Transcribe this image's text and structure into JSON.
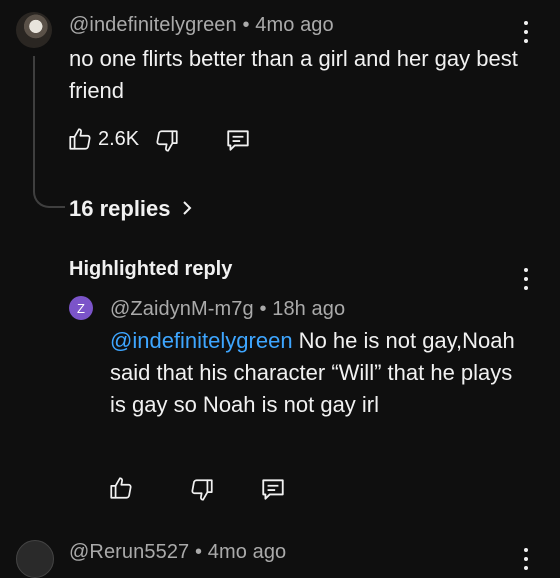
{
  "comment": {
    "author": "@indefinitelygreen",
    "separator": "•",
    "time": "4mo ago",
    "text": "no one flirts better than a girl and her gay best friend",
    "likes": "2.6K",
    "replies_label": "16 replies"
  },
  "highlighted": {
    "heading": "Highlighted reply",
    "avatar_letter": "Z",
    "author": "@ZaidynM-m7g",
    "separator": "•",
    "time": "18h ago",
    "mention": "@indefinitelygreen",
    "text": " No he is not gay,Noah said that his character “Will” that he plays is gay so Noah is not gay irl"
  },
  "next_comment": {
    "author": "@Rerun5527",
    "separator": "•",
    "time": "4mo ago"
  },
  "colors": {
    "background": "#0f0f0f",
    "mention": "#3ea6ff",
    "meta": "#aaaaaa",
    "avatar_z": "#7b54c9"
  },
  "icons": [
    "like-icon",
    "dislike-icon",
    "reply-icon",
    "more-icon",
    "chevron-right-icon"
  ]
}
